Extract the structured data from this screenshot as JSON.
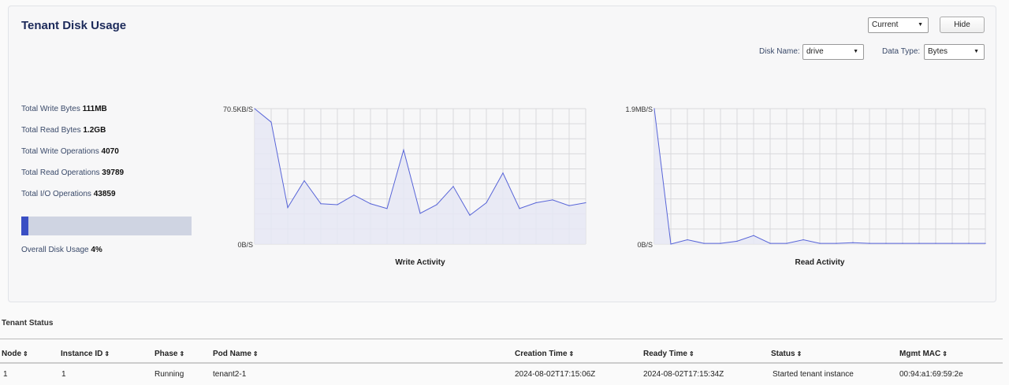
{
  "panel": {
    "title": "Tenant Disk Usage",
    "time_select": "Current",
    "hide_label": "Hide",
    "disk_name_label": "Disk Name:",
    "disk_name_value": "drive",
    "data_type_label": "Data Type:",
    "data_type_value": "Bytes"
  },
  "stats": [
    {
      "label": "Total Write Bytes",
      "value": "111MB"
    },
    {
      "label": "Total Read Bytes",
      "value": "1.2GB"
    },
    {
      "label": "Total Write Operations",
      "value": "4070"
    },
    {
      "label": "Total Read Operations",
      "value": "39789"
    },
    {
      "label": "Total I/O Operations",
      "value": "43859"
    }
  ],
  "usage": {
    "label": "Overall Disk Usage",
    "value": "4%",
    "fraction": 0.04
  },
  "chart_data": [
    {
      "type": "area",
      "title": "Write Activity",
      "ytick_top": "70.5KB/S",
      "ytick_bottom": "0B/S",
      "ylim": [
        0,
        70.5
      ],
      "unit": "KB/S",
      "values": [
        70.5,
        63.5,
        19,
        33,
        21,
        20.5,
        25.5,
        21,
        18.5,
        49,
        16,
        20.5,
        30,
        15,
        21.5,
        37,
        18.5,
        21.5,
        23,
        20,
        21.5
      ],
      "grid": true
    },
    {
      "type": "area",
      "title": "Read Activity",
      "ytick_top": "1.9MB/S",
      "ytick_bottom": "0B/S",
      "ylim": [
        0,
        1.9
      ],
      "unit": "MB/S",
      "values": [
        1.9,
        0.0,
        0.06,
        0.01,
        0.01,
        0.04,
        0.12,
        0.01,
        0.01,
        0.06,
        0.01,
        0.01,
        0.02,
        0.01,
        0.01,
        0.01,
        0.01,
        0.01,
        0.01,
        0.01,
        0.01
      ],
      "grid": true
    }
  ],
  "tenant_status": {
    "title": "Tenant Status",
    "columns": [
      "Node",
      "Instance ID",
      "Phase",
      "Pod Name",
      "Creation Time",
      "Ready Time",
      "Status",
      "Mgmt MAC"
    ],
    "rows": [
      [
        "1",
        "1",
        "Running",
        "tenant2-1",
        "2024-08-02T17:15:06Z",
        "2024-08-02T17:15:34Z",
        "Started tenant instance",
        "00:94:a1:69:59:2e"
      ]
    ],
    "sort_icon": "sort-icon"
  },
  "colors": {
    "line": "#5865d8",
    "fill": "#e6e8f4",
    "grid": "#d8d8dc",
    "usage_fill": "#3a4fc4",
    "usage_bg": "#cfd4e2",
    "title": "#1c2a5a"
  }
}
